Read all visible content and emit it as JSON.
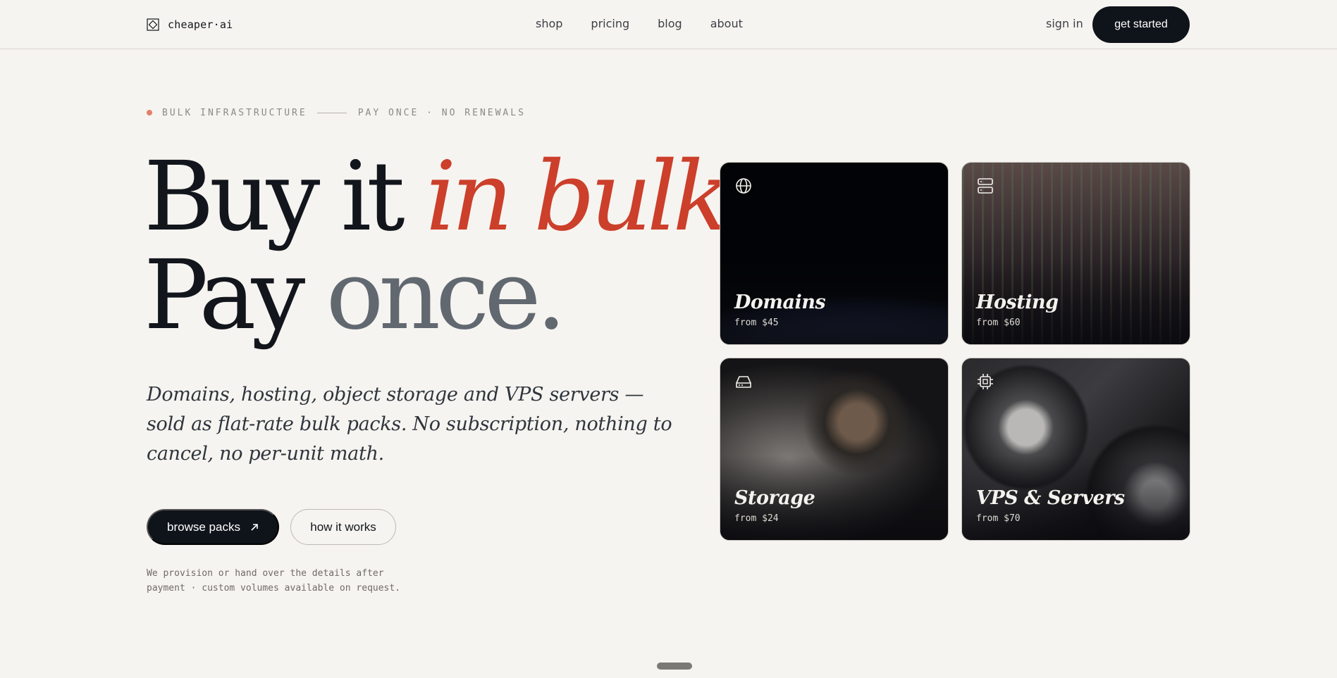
{
  "nav": {
    "brand": "cheaper·ai",
    "links": [
      "shop",
      "pricing",
      "blog",
      "about"
    ],
    "sign_in": "sign in",
    "get_started": "get started"
  },
  "hero": {
    "eyebrow_left": "BULK INFRASTRUCTURE",
    "eyebrow_right": "PAY ONCE · NO RENEWALS",
    "headline": {
      "line1_a": "Buy it ",
      "line1_b": "in bulk.",
      "line2_a": "Pay ",
      "line2_b": "once."
    },
    "lede": "Domains, hosting, object storage and VPS servers — sold as flat-rate bulk packs. No subscription, nothing to cancel, no per-unit math.",
    "primary_cta": "browse packs",
    "secondary_cta": "how it works",
    "footnote_line1": "We provision or hand over the details after",
    "footnote_line2": "payment · custom volumes available on request."
  },
  "products": [
    {
      "title": "Domains",
      "price": "from $45",
      "icon": "globe-icon"
    },
    {
      "title": "Hosting",
      "price": "from $60",
      "icon": "server-icon"
    },
    {
      "title": "Storage",
      "price": "from $24",
      "icon": "hard-drive-icon"
    },
    {
      "title": "VPS & Servers",
      "price": "from $70",
      "icon": "cpu-icon"
    }
  ],
  "colors": {
    "background": "#f6f4f0",
    "ink": "#12161c",
    "accent": "#cc3f2b",
    "muted": "#616870",
    "dot": "#e2806a"
  }
}
